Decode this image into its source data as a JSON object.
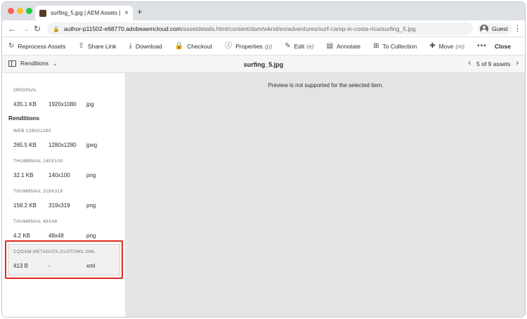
{
  "browser": {
    "tab_title": "surfing_5.jpg | AEM Assets | Ad",
    "tab_close": "×",
    "new_tab": "+",
    "url_host": "author-p11502-e68770.adobeaemcloud.com",
    "url_path": "/assetdetails.html/content/dam/wknd/en/adventures/surf-camp-in-costa-rica/surfing_5.jpg",
    "profile_label": "Guest"
  },
  "actions": {
    "reprocess": "Reprocess Assets",
    "share": "Share Link",
    "download": "Download",
    "checkout": "Checkout",
    "properties": "Properties",
    "properties_key": "(p)",
    "edit": "Edit",
    "edit_key": "(e)",
    "annotate": "Annotate",
    "collection": "To Collection",
    "move": "Move",
    "move_key": "(m)",
    "more": "•••",
    "close": "Close"
  },
  "subbar": {
    "rail_label": "Renditions",
    "file_name": "surfing_5.jpg",
    "pager_text": "5 of 9 assets"
  },
  "renditions": {
    "original_label": "ORIGINAL",
    "original": {
      "size": "435.1 KB",
      "dimensions": "1920x1080",
      "type": "jpg"
    },
    "heading": "Renditions",
    "items": [
      {
        "label": "WEB 1280X1280",
        "size": "265.5 KB",
        "dimensions": "1280x1280",
        "type": "jpeg"
      },
      {
        "label": "THUMBNAIL 140X100",
        "size": "32.1 KB",
        "dimensions": "140x100",
        "type": "png"
      },
      {
        "label": "THUMBNAIL 319X319",
        "size": "158.2 KB",
        "dimensions": "319x319",
        "type": "png"
      },
      {
        "label": "THUMBNAIL 48X48",
        "size": "4.2 KB",
        "dimensions": "48x48",
        "type": "png"
      },
      {
        "label": "CQDAM.METADATA.CUSTOM1.XML",
        "size": "413 B",
        "dimensions": "-",
        "type": "xml"
      }
    ]
  },
  "preview": {
    "message": "Preview is not supported for the selected item."
  },
  "colors": {
    "highlight": "#e0291e",
    "preview_bg": "#e4e4e4"
  }
}
